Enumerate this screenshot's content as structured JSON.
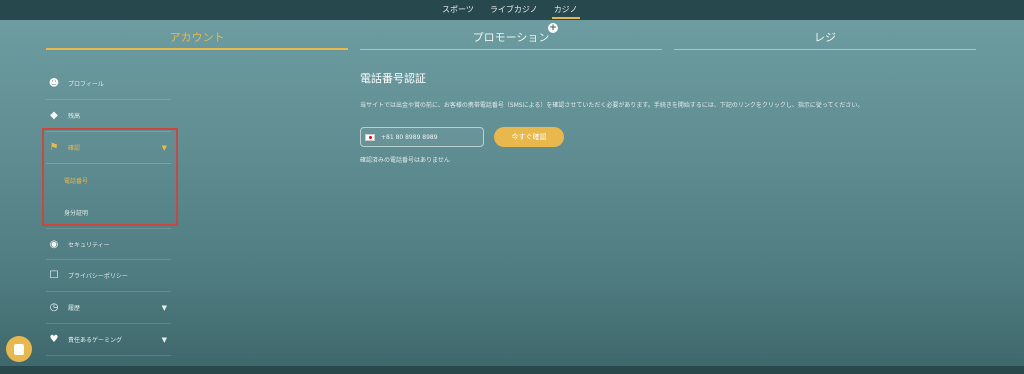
{
  "top_nav": [
    "スポーツ",
    "ライブカジノ",
    "カジノ"
  ],
  "tabs": [
    "アカウント",
    "プロモーション",
    "レジ"
  ],
  "sidebar": {
    "items": [
      {
        "label": "プロフィール",
        "icon": "profile-icon"
      },
      {
        "label": "残高",
        "icon": "balance-icon"
      },
      {
        "label": "確認",
        "icon": "verify-icon"
      },
      {
        "label": "セキュリティー",
        "icon": "security-icon"
      },
      {
        "label": "プライバシーポリシー",
        "icon": "lock-icon"
      },
      {
        "label": "履歴",
        "icon": "clock-icon"
      },
      {
        "label": "責任あるゲーミング",
        "icon": "responsible-gaming-icon"
      }
    ],
    "sub_items": [
      "電話番号",
      "身分証明"
    ]
  },
  "main": {
    "title": "電話番号認証",
    "description": "当サイトでは出金や賞の前に、お客様の携帯電話番号（SMSによる）を確認させていただく必要があります。手続きを開始するには、下記のリンクをクリックし、指示に従ってください。",
    "phone_value": "+81 80 8989 8989",
    "verify_button": "今すぐ確認",
    "note": "確認済みの電話番号はありません"
  },
  "colors": {
    "accent": "#e8b84d",
    "highlight": "#c9473b"
  }
}
